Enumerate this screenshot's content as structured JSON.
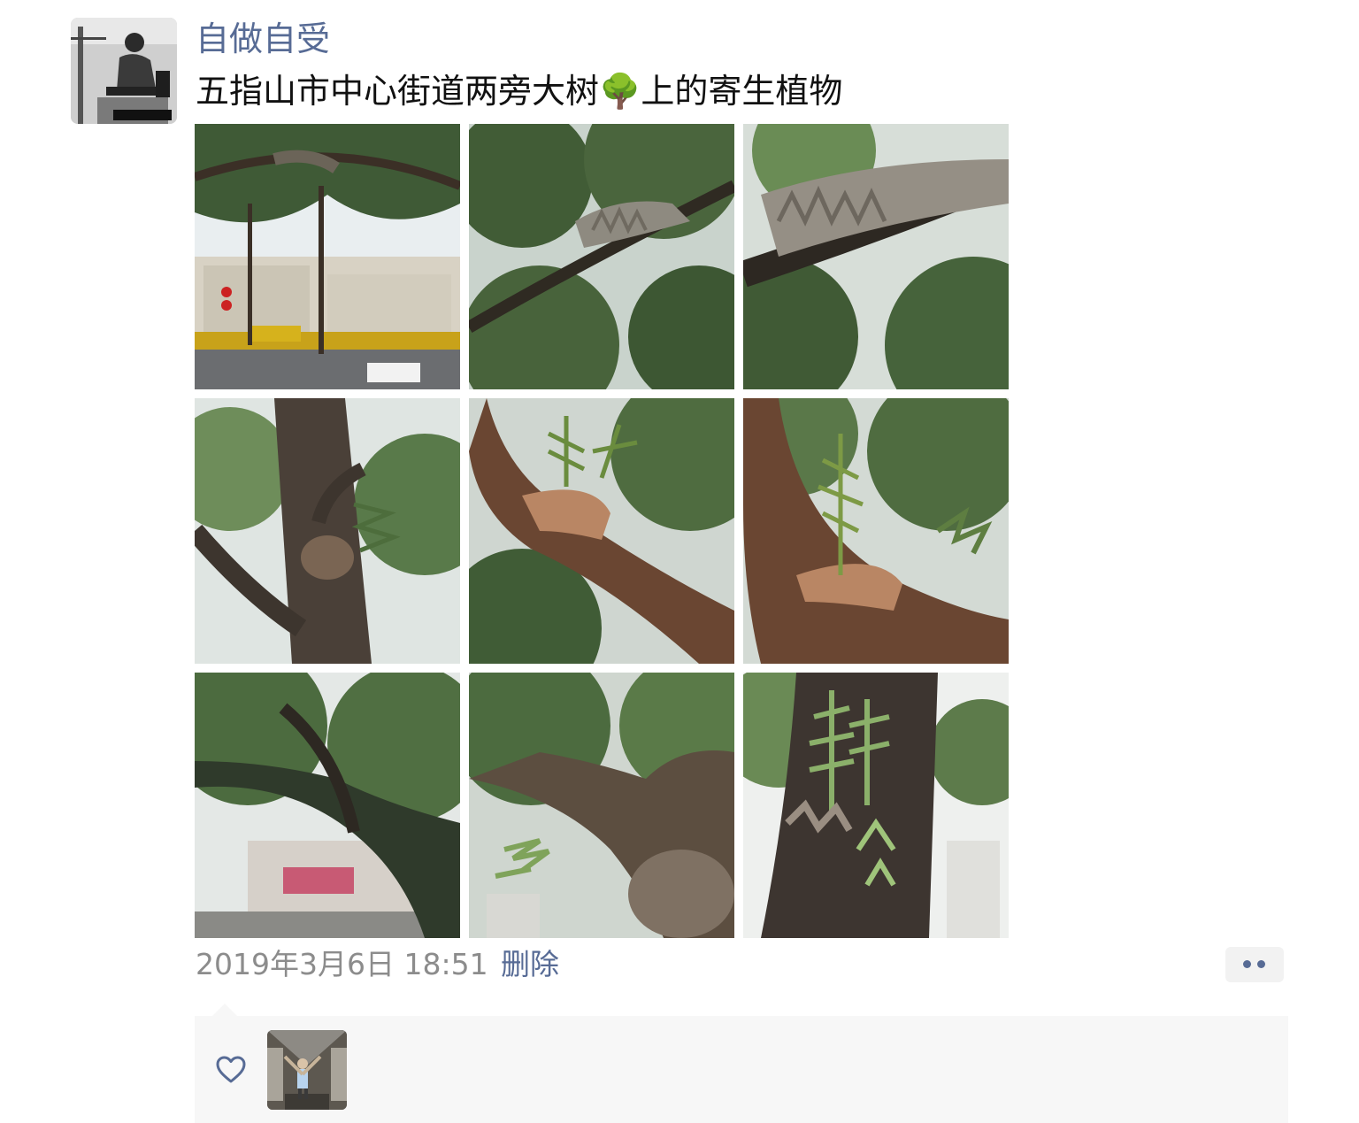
{
  "post": {
    "author_name": "自做自受",
    "text": "五指山市中心街道两旁大树🌳上的寄生植物",
    "timestamp": "2019年3月6日 18:51",
    "delete_label": "删除",
    "photo_count": 9
  },
  "icons": {
    "more": "more-dots-icon",
    "like": "heart-icon"
  },
  "colors": {
    "link_blue": "#576b95",
    "meta_gray": "#8c8c8c",
    "panel_bg": "#f7f7f7"
  }
}
